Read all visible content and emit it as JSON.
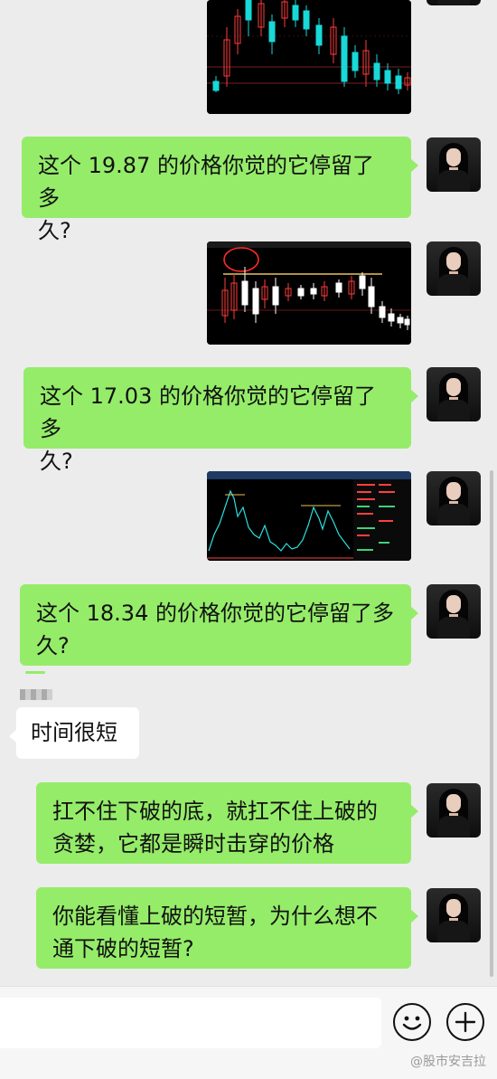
{
  "messages": [
    {
      "kind": "image",
      "from": "self",
      "chart": "candles-dark"
    },
    {
      "kind": "text",
      "from": "self",
      "text_line1": "这个 19.87 的价格你觉的它停留了多",
      "text_line2": "久?"
    },
    {
      "kind": "image",
      "from": "self",
      "chart": "candles-circle"
    },
    {
      "kind": "text",
      "from": "self",
      "text_line1": "这个 17.03 的价格你觉的它停留了多",
      "text_line2": "久?"
    },
    {
      "kind": "image",
      "from": "self",
      "chart": "line-tick"
    },
    {
      "kind": "text",
      "from": "self",
      "text_line1": "这个 18.34 的价格你觉的它停留了多",
      "text_line2": "久?"
    },
    {
      "kind": "text",
      "from": "other",
      "text": "时间很短"
    },
    {
      "kind": "text",
      "from": "self",
      "text_line1": "扛不住下破的底，就扛不住上破的",
      "text_line2": "贪婪，它都是瞬时击穿的价格"
    },
    {
      "kind": "text",
      "from": "self",
      "text_line1": "你能看懂上破的短暂，为什么想不",
      "text_line2": "通下破的短暂?"
    }
  ],
  "input_bar": {
    "emoji_icon": "smile-icon",
    "plus_icon": "plus-icon"
  },
  "watermark": "@股市安吉拉",
  "colors": {
    "self_bubble": "#95ec69",
    "other_bubble": "#ffffff",
    "background": "#ececec"
  }
}
